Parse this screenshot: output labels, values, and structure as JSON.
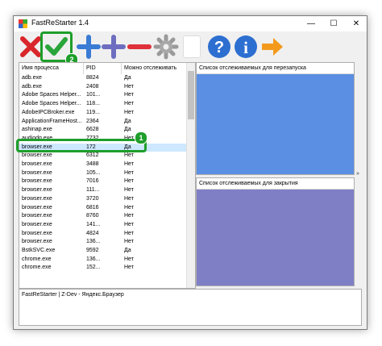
{
  "window": {
    "title": "FastReStarter 1.4"
  },
  "title_controls": {
    "minimize": "—",
    "maximize": "☐",
    "close": "✕"
  },
  "toolbar": {
    "buttons": [
      "remove",
      "apply",
      "add-restart",
      "add-close",
      "delete",
      "settings",
      "blank",
      "help",
      "about",
      "exit"
    ],
    "badge_apply": "2"
  },
  "process_list": {
    "headers": {
      "name": "Имя процесса",
      "pid": "PID",
      "trackable": "Можно отслеживать"
    },
    "rows": [
      [
        "adb.exe",
        "8824",
        "Да"
      ],
      [
        "adb.exe",
        "2408",
        "Нет"
      ],
      [
        "Adobe Spaces Helper...",
        "101...",
        "Нет"
      ],
      [
        "Adobe Spaces Helper...",
        "118...",
        "Нет"
      ],
      [
        "AdobeIPCBroker.exe",
        "119...",
        "Нет"
      ],
      [
        "ApplicationFrameHost...",
        "2364",
        "Да"
      ],
      [
        "ashinap.exe",
        "6628",
        "Да"
      ],
      [
        "audiodg.exe",
        "7732",
        "Нет"
      ],
      [
        "browser.exe",
        "172",
        "Да"
      ],
      [
        "browser.exe",
        "6312",
        "Нет"
      ],
      [
        "browser.exe",
        "3488",
        "Нет"
      ],
      [
        "browser.exe",
        "105...",
        "Нет"
      ],
      [
        "browser.exe",
        "7016",
        "Нет"
      ],
      [
        "browser.exe",
        "111...",
        "Нет"
      ],
      [
        "browser.exe",
        "3720",
        "Нет"
      ],
      [
        "browser.exe",
        "6816",
        "Нет"
      ],
      [
        "browser.exe",
        "8760",
        "Нет"
      ],
      [
        "browser.exe",
        "141...",
        "Нет"
      ],
      [
        "browser.exe",
        "4824",
        "Нет"
      ],
      [
        "browser.exe",
        "136...",
        "Нет"
      ],
      [
        "BstkSVC.exe",
        "9592",
        "Да"
      ],
      [
        "chrome.exe",
        "136...",
        "Нет"
      ],
      [
        "chrome.exe",
        "152...",
        "Нет"
      ]
    ],
    "selected_index": 8,
    "badge_selected": "1"
  },
  "restart_list": {
    "title": "Список отслеживаемых для перезапуска",
    "color": "#5b8fe3"
  },
  "close_list": {
    "title": "Список отслеживаемых для закрытия",
    "color": "#7f7fc6"
  },
  "collapse_glyph": "»",
  "status": {
    "text": "FastReStarter | Z-Dev - Яндекс.Браузер"
  }
}
